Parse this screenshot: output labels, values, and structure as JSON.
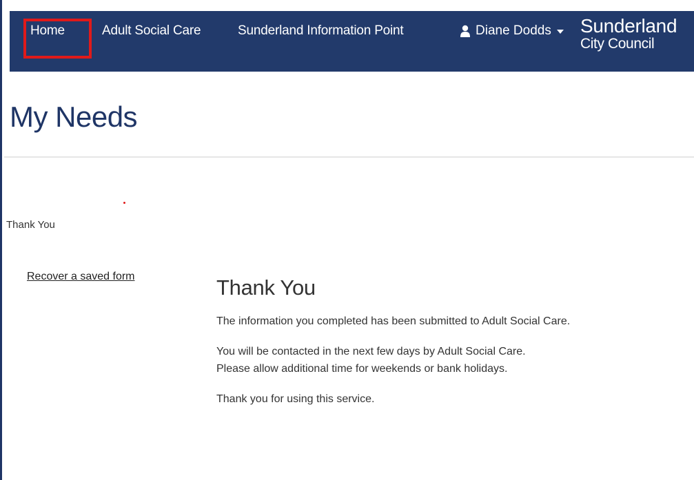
{
  "nav": {
    "home": "Home",
    "adult_social_care": "Adult Social Care",
    "information_point": "Sunderland Information Point",
    "user_name": "Diane Dodds"
  },
  "brand": {
    "line1": "Sunderland",
    "line2": "City Council"
  },
  "page": {
    "title": "My Needs",
    "breadcrumb": "Thank You",
    "recover_link": "Recover a saved form"
  },
  "content": {
    "heading": "Thank You",
    "p1": "The information you completed has been submitted to Adult Social Care.",
    "p2_line1": "You will be contacted in the next few days by Adult Social Care.",
    "p2_line2": "Please allow additional time for weekends or bank holidays.",
    "p3": "Thank you for using this service."
  },
  "colors": {
    "navbar": "#223a6b",
    "title": "#1f3566",
    "highlight": "#e01a1a"
  }
}
